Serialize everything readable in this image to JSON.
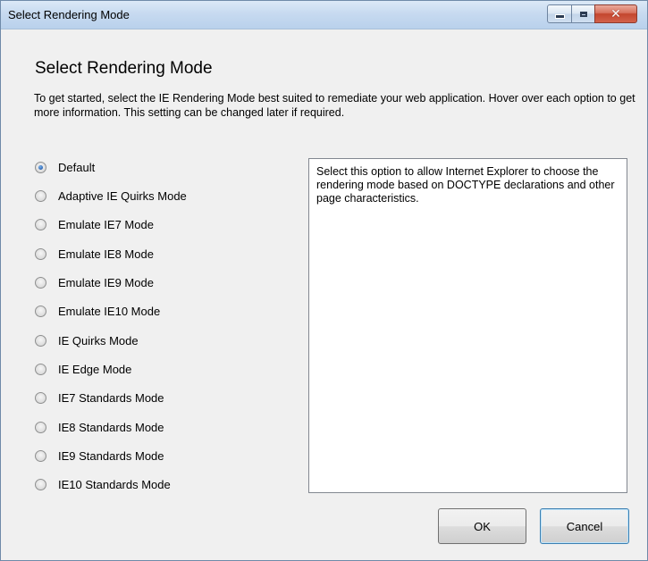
{
  "window": {
    "title": "Select Rendering Mode",
    "controls": {
      "minimize": "minimize-icon",
      "maximize": "maximize-icon",
      "close": "close-icon"
    }
  },
  "heading": "Select Rendering Mode",
  "intro": "To get started, select the IE Rendering Mode best suited to remediate your web application. Hover over each option to get more information. This setting can be changed later if required.",
  "options": [
    {
      "label": "Default",
      "checked": true
    },
    {
      "label": "Adaptive IE Quirks Mode",
      "checked": false
    },
    {
      "label": "Emulate IE7 Mode",
      "checked": false
    },
    {
      "label": "Emulate IE8 Mode",
      "checked": false
    },
    {
      "label": "Emulate IE9 Mode",
      "checked": false
    },
    {
      "label": "Emulate IE10 Mode",
      "checked": false
    },
    {
      "label": "IE Quirks Mode",
      "checked": false
    },
    {
      "label": "IE Edge Mode",
      "checked": false
    },
    {
      "label": "IE7 Standards Mode",
      "checked": false
    },
    {
      "label": "IE8 Standards Mode",
      "checked": false
    },
    {
      "label": "IE9 Standards Mode",
      "checked": false
    },
    {
      "label": "IE10 Standards Mode",
      "checked": false
    }
  ],
  "description": "Select this option to allow Internet Explorer to choose the rendering mode based on DOCTYPE declarations and other page characteristics.",
  "buttons": {
    "ok": "OK",
    "cancel": "Cancel"
  },
  "colors": {
    "titlebar": "#c7daf0",
    "dialog_bg": "#f0f0f0",
    "close_button": "#c3462e",
    "radio_selected": "#2b64b3"
  }
}
